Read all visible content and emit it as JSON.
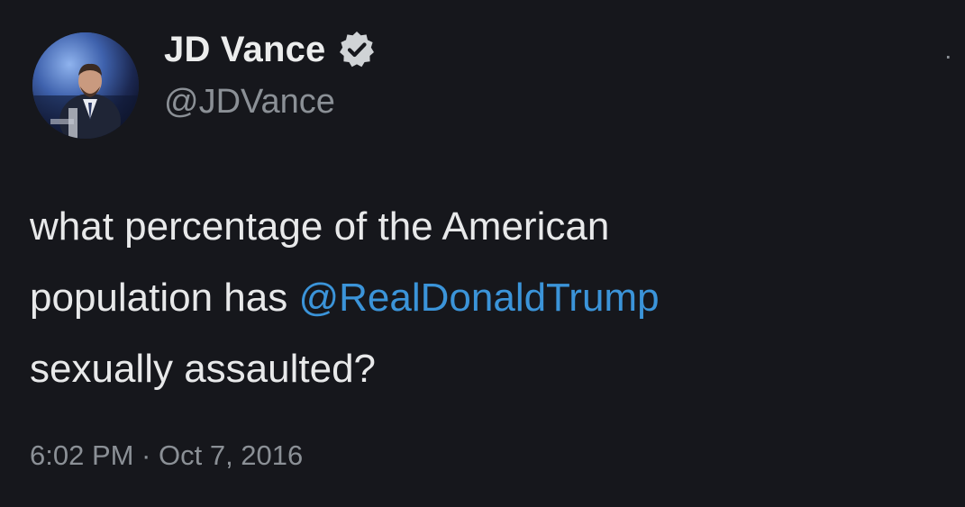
{
  "author": {
    "display_name": "JD Vance",
    "handle": "@JDVance",
    "verified": true,
    "avatar": "profile-photo"
  },
  "tweet": {
    "line1": "what percentage of the American",
    "line2_prefix": "population has ",
    "mention": "@RealDonaldTrump",
    "line3": "sexually assaulted?",
    "timestamp": "6:02 PM · Oct 7, 2016"
  },
  "colors": {
    "background": "#16171c",
    "mention": "#3b94d9",
    "verified_badge": "#d0d3d6"
  },
  "icons": {
    "verified": "verified-badge-icon",
    "more": "more-options-icon"
  }
}
